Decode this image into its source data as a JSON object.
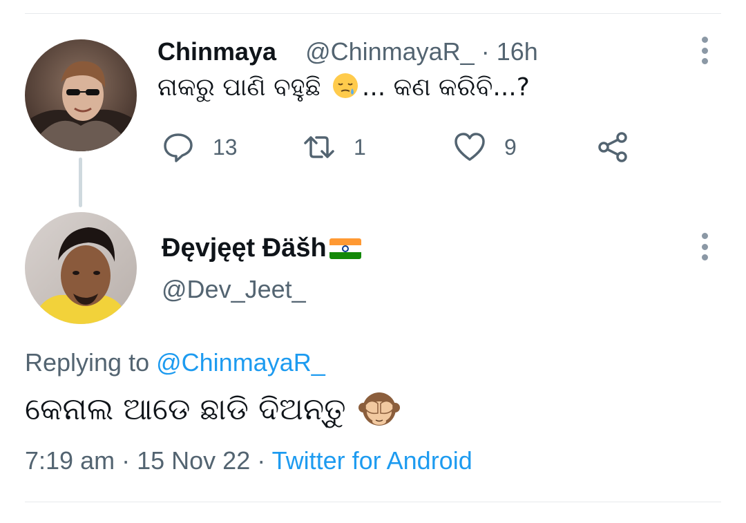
{
  "tweet1": {
    "display_name": "Chinmaya",
    "handle": "@ChinmayaR_",
    "separator": "·",
    "time": "16h",
    "text_before_emoji": "ନାକରୁ ପାଣି ବହୁଛି ",
    "emoji": "sleepy-face",
    "text_after_emoji": "... କଣ କରିବି...?",
    "actions": {
      "replies": "13",
      "retweets": "1",
      "likes": "9"
    }
  },
  "tweet2": {
    "display_name": "Đęvjęęt Đäšh",
    "flag": "india-flag",
    "handle": "@Dev_Jeet_",
    "replying_prefix": "Replying to ",
    "replying_mention": "@ChinmayaR_",
    "text": "କେନାଲ ଆଡେ ଛାଡି ଦିଅନ୍ତୁ",
    "emoji": "see-no-evil-monkey",
    "timestamp": "7:19 am",
    "date": "15 Nov 22",
    "separator": "·",
    "client": "Twitter for Android"
  },
  "colors": {
    "primary_text": "#0f1419",
    "secondary_text": "#536471",
    "link": "#1d9bf0",
    "divider": "#e6e9ec"
  }
}
